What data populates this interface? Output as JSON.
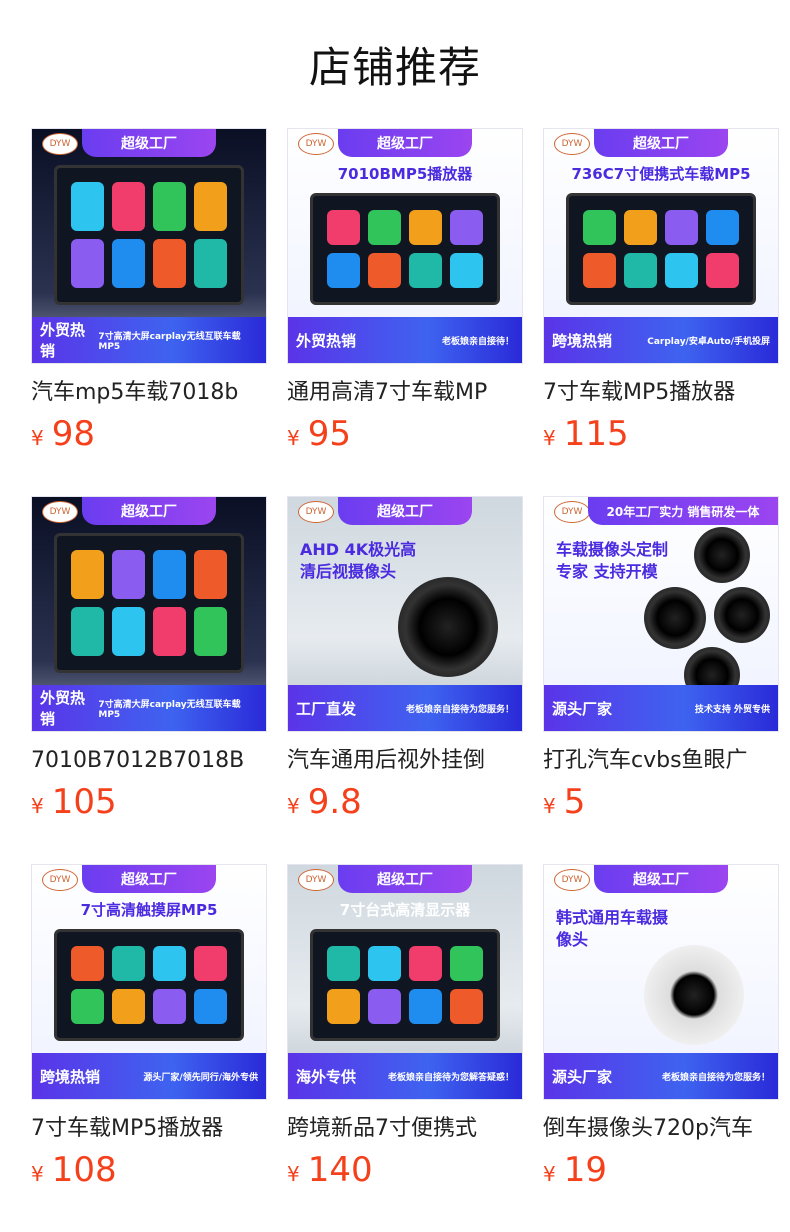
{
  "page_title": "店铺推荐",
  "currency": "¥",
  "products": [
    {
      "title": "汽车mp5车载7018b",
      "price": "98",
      "badge": "超级工厂",
      "headline": "",
      "band_left": "外贸热销",
      "band_right": "7寸高清大屏carplay无线互联车载MP5",
      "theme": "dark"
    },
    {
      "title": "通用高清7寸车载MP",
      "price": "95",
      "badge": "超级工厂",
      "headline": "7010BMP5播放器",
      "band_left": "外贸热销",
      "band_right": "老板娘亲自接待！",
      "theme": "light"
    },
    {
      "title": "7寸车载MP5播放器",
      "price": "115",
      "badge": "超级工厂",
      "headline": "736C7寸便携式车载MP5",
      "band_left": "跨境热销",
      "band_right": "Carplay/安卓Auto/手机投屏",
      "theme": "light"
    },
    {
      "title": "7010B7012B7018B",
      "price": "105",
      "badge": "超级工厂",
      "headline": "",
      "band_left": "外贸热销",
      "band_right": "7寸高清大屏carplay无线互联车载MP5",
      "theme": "dark"
    },
    {
      "title": "汽车通用后视外挂倒",
      "price": "9.8",
      "badge": "超级工厂",
      "headline": "AHD 4K极光高清后视摄像头",
      "band_left": "工厂直发",
      "band_right": "老板娘亲自接待为您服务！",
      "theme": "photo"
    },
    {
      "title": "打孔汽车cvbs鱼眼广",
      "price": "5",
      "badge": "20年工厂实力 销售研发一体",
      "headline": "车载摄像头定制专家 支持开模",
      "band_left": "源头厂家",
      "band_right": "技术支持 外贸专供",
      "theme": "light"
    },
    {
      "title": "7寸车载MP5播放器",
      "price": "108",
      "badge": "超级工厂",
      "headline": "7寸高清触摸屏MP5",
      "band_left": "跨境热销",
      "band_right": "源头厂家/领先同行/海外专供",
      "theme": "light"
    },
    {
      "title": "跨境新品7寸便携式",
      "price": "140",
      "badge": "超级工厂",
      "headline": "7寸台式高清显示器",
      "band_left": "海外专供",
      "band_right": "老板娘亲自接待为您解答疑惑！",
      "theme": "photo"
    },
    {
      "title": "倒车摄像头720p汽车",
      "price": "19",
      "badge": "超级工厂",
      "headline": "韩式通用车载摄像头",
      "band_left": "源头厂家",
      "band_right": "老板娘亲自接待为您服务！",
      "theme": "light"
    }
  ]
}
